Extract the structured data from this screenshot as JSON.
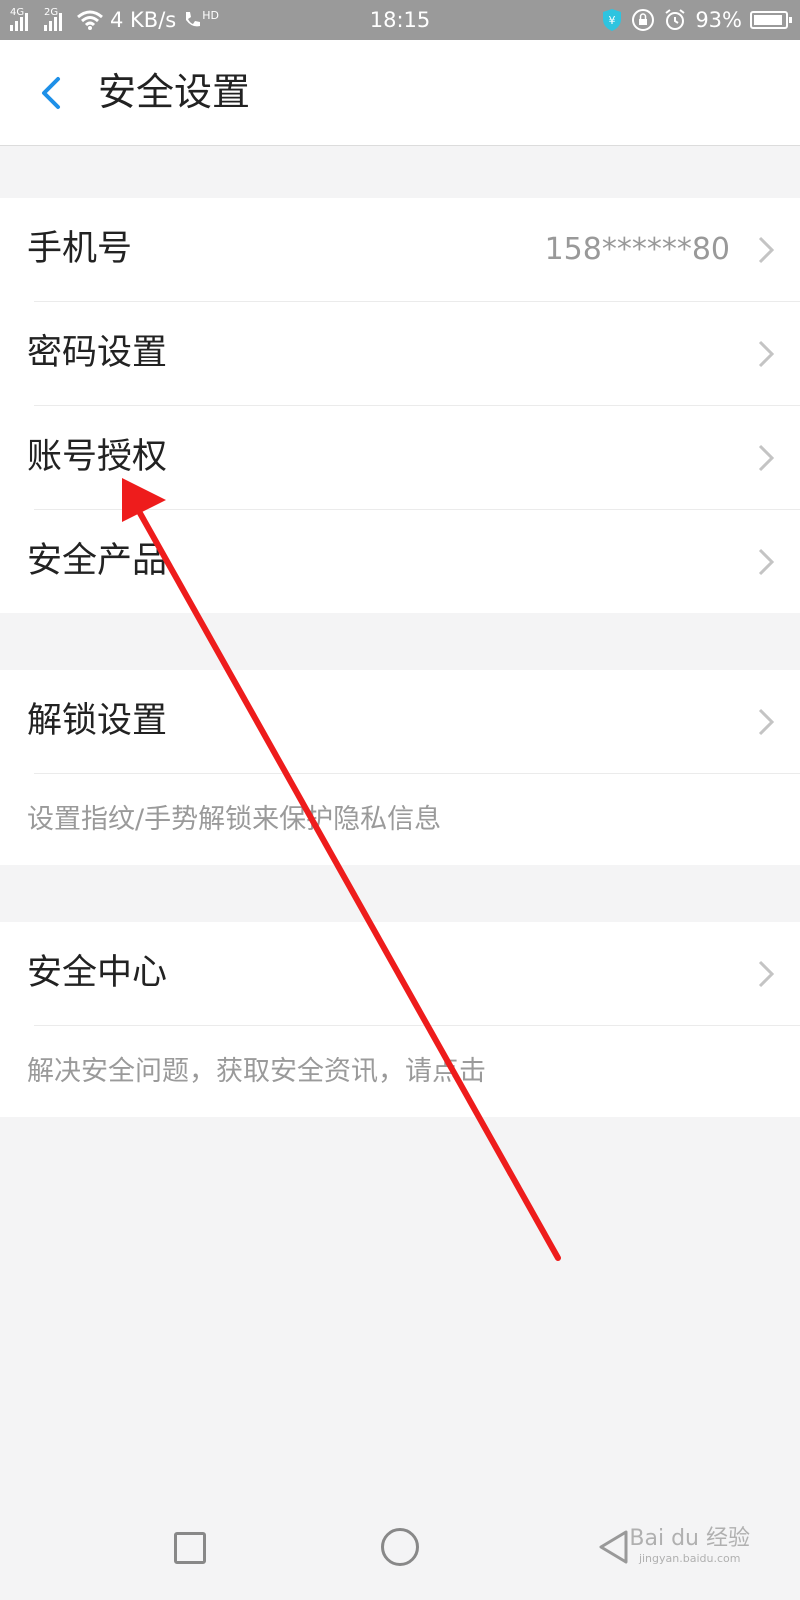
{
  "status_bar": {
    "network_4g": "4G",
    "network_2g": "2G",
    "speed": "4 KB/s",
    "call_icon_text": "HD",
    "time": "18:15",
    "battery": "93%",
    "battery_level": 0.93
  },
  "header": {
    "title": "安全设置"
  },
  "section1": {
    "phone": {
      "label": "手机号",
      "value": "158******80"
    },
    "password": {
      "label": "密码设置"
    },
    "auth": {
      "label": "账号授权"
    },
    "products": {
      "label": "安全产品"
    }
  },
  "section2": {
    "unlock": {
      "label": "解锁设置",
      "desc": "设置指纹/手势解锁来保护隐私信息"
    }
  },
  "section3": {
    "center": {
      "label": "安全中心",
      "desc": "解决安全问题，获取安全资讯，请点击"
    }
  },
  "watermark": {
    "text": "Bai du 经验",
    "sub": "jingyan.baidu.com"
  },
  "colors": {
    "accent": "#1e90e8",
    "arrow": "#ee1c1c"
  }
}
